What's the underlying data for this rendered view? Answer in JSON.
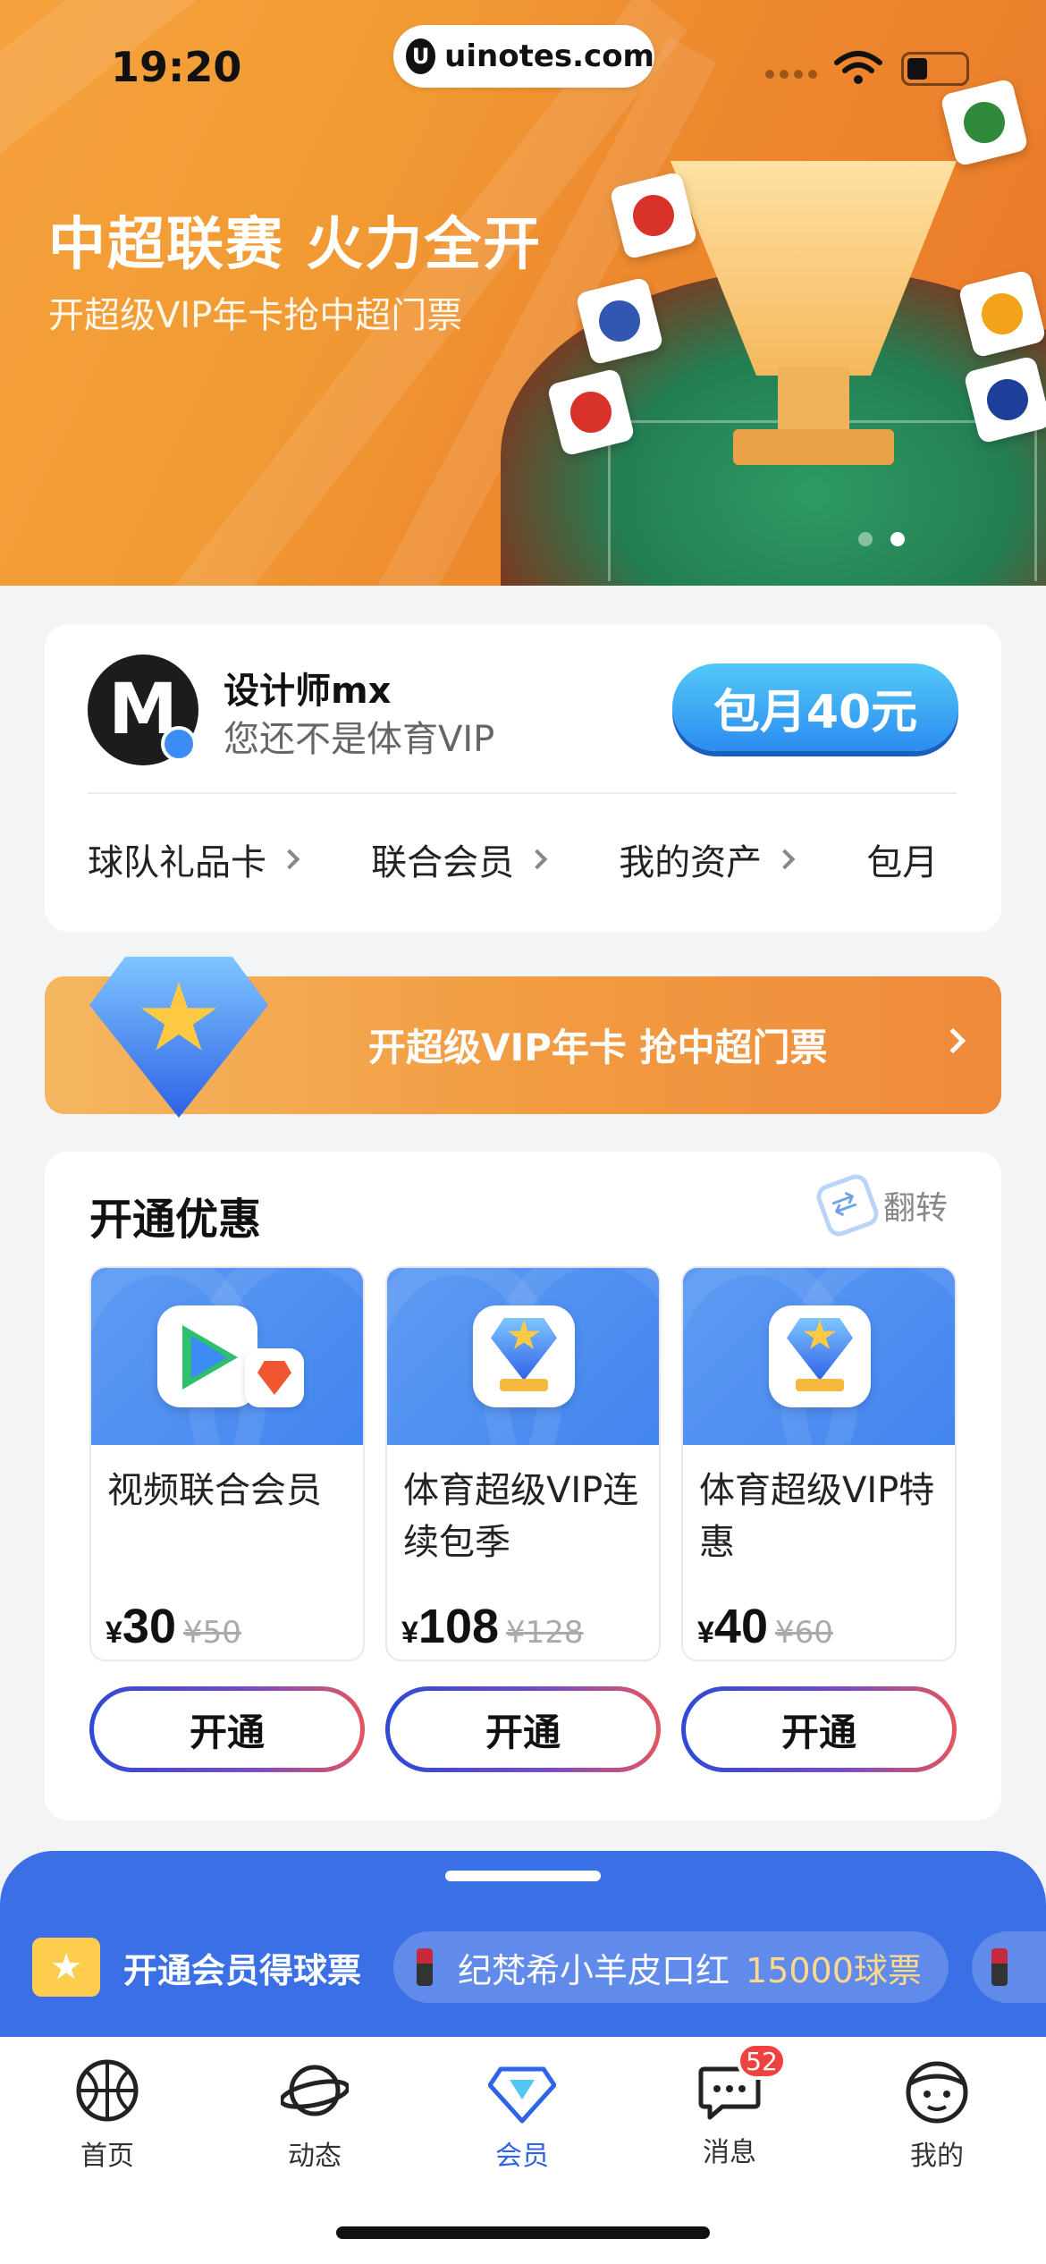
{
  "status_bar": {
    "time": "19:20",
    "url": "uinotes.com",
    "url_logo": "U"
  },
  "banner": {
    "title": "中超联赛 火力全开",
    "subtitle": "开超级VIP年卡抢中超门票",
    "page_count": 2,
    "active_page": 1
  },
  "profile": {
    "avatar_letter": "M",
    "username": "设计师mx",
    "vip_status": "您还不是体育VIP",
    "monthly_button": "包月40元",
    "quick_links": [
      "球队礼品卡",
      "联合会员",
      "我的资产",
      "包月"
    ]
  },
  "promo": {
    "text": "开超级VIP年卡 抢中超门票"
  },
  "offers": {
    "title": "开通优惠",
    "flip_label": "翻转",
    "items": [
      {
        "name": "视频联合会员",
        "currency": "¥",
        "price": "30",
        "original": "¥50",
        "button": "开通",
        "icon": "video-app-icon"
      },
      {
        "name": "体育超级VIP连续包季",
        "currency": "¥",
        "price": "108",
        "original": "¥128",
        "button": "开通",
        "icon": "vip-diamond-icon"
      },
      {
        "name": "体育超级VIP特惠",
        "currency": "¥",
        "price": "40",
        "original": "¥60",
        "button": "开通",
        "icon": "vip-diamond-icon"
      }
    ]
  },
  "ticket_panel": {
    "label": "开通会员得球票",
    "item_name": "纪梵希小羊皮口红",
    "item_points": "15000球票"
  },
  "tabbar": {
    "items": [
      {
        "label": "首页",
        "icon": "basketball-icon",
        "active": false
      },
      {
        "label": "动态",
        "icon": "planet-icon",
        "active": false
      },
      {
        "label": "会员",
        "icon": "diamond-icon",
        "active": true
      },
      {
        "label": "消息",
        "icon": "chat-icon",
        "active": false,
        "badge": "52"
      },
      {
        "label": "我的",
        "icon": "face-icon",
        "active": false
      }
    ]
  },
  "colors": {
    "accent_blue": "#2f64e6",
    "banner_orange": "#f19a34",
    "badge_red": "#f04141",
    "panel_blue": "#3a6fe6"
  }
}
